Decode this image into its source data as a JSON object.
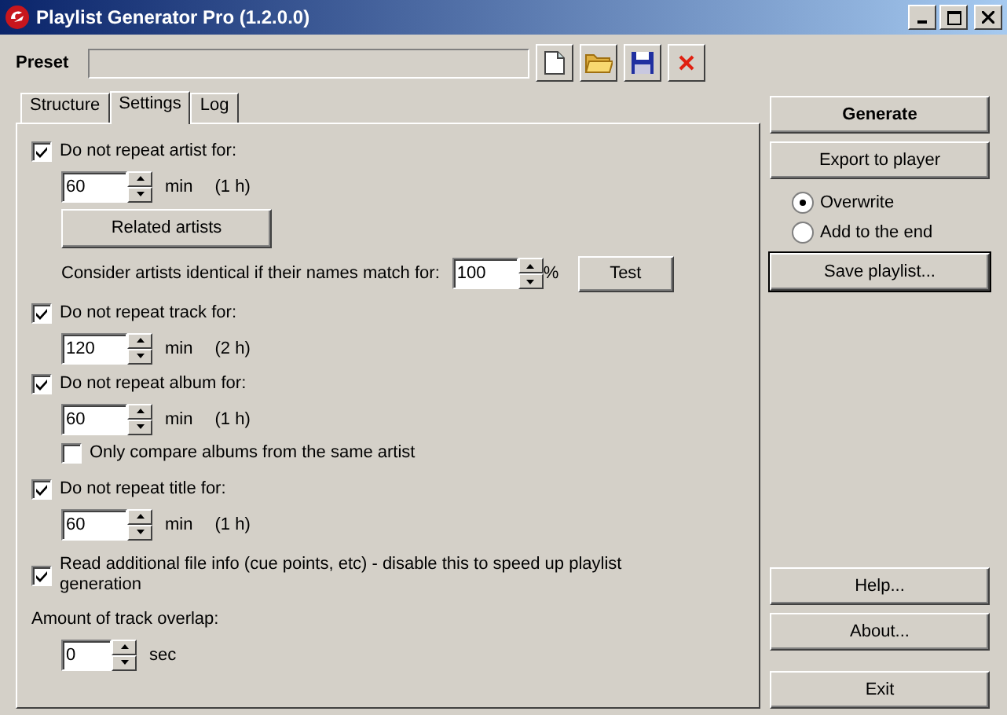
{
  "window": {
    "title": "Playlist Generator Pro (1.2.0.0)"
  },
  "preset": {
    "label": "Preset"
  },
  "tabs": [
    {
      "label": "Structure",
      "selected": false
    },
    {
      "label": "Settings",
      "selected": true
    },
    {
      "label": "Log",
      "selected": false
    }
  ],
  "settings": [
    {
      "kind": "checkbox",
      "label": "Do not repeat artist for:",
      "checked": true
    },
    {
      "kind": "spin",
      "value": "60",
      "unit": "min",
      "note": "(1 h)"
    },
    {
      "kind": "button",
      "label": "Related artists"
    },
    {
      "kind": "match",
      "label": "Consider artists identical if their names match for:",
      "value": "100",
      "unit": "%",
      "button": "Test"
    },
    {
      "kind": "checkbox",
      "label": "Do not repeat track for:",
      "checked": true
    },
    {
      "kind": "spin",
      "value": "120",
      "unit": "min",
      "note": "(2 h)"
    },
    {
      "kind": "checkbox",
      "label": "Do not repeat album for:",
      "checked": true
    },
    {
      "kind": "spin",
      "value": "60",
      "unit": "min",
      "note": "(1 h)"
    },
    {
      "kind": "subcheckbox",
      "label": "Only compare albums from the same artist",
      "checked": false
    },
    {
      "kind": "checkbox",
      "label": "Do not repeat title for:",
      "checked": true
    },
    {
      "kind": "spin",
      "value": "60",
      "unit": "min",
      "note": "(1 h)"
    },
    {
      "kind": "longcheckbox",
      "label": "Read additional file info (cue points, etc) - disable this to speed up playlist generation",
      "checked": true
    },
    {
      "kind": "label",
      "label": "Amount of track overlap:"
    },
    {
      "kind": "smallspin",
      "value": "0",
      "unit": "sec"
    }
  ],
  "side": {
    "generate": "Generate",
    "export": "Export to player",
    "export_modes": [
      {
        "label": "Overwrite",
        "selected": true
      },
      {
        "label": "Add to the end",
        "selected": false
      }
    ],
    "save": "Save playlist...",
    "help": "Help...",
    "about": "About...",
    "exit": "Exit"
  }
}
